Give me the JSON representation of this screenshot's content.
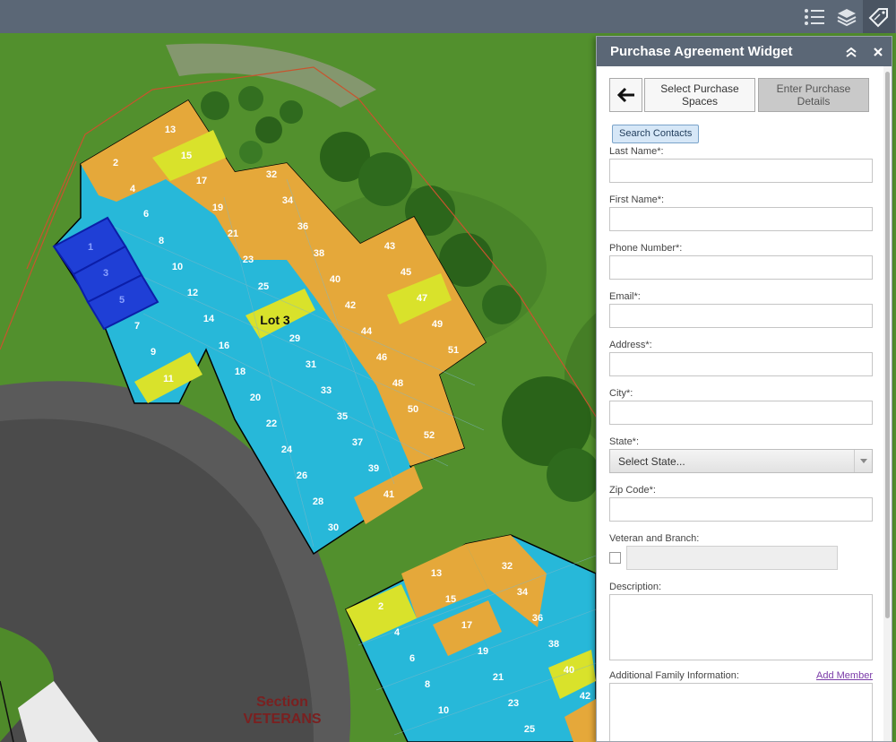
{
  "toolbar": {
    "icons": [
      "list-icon",
      "layers-icon",
      "tag-icon"
    ]
  },
  "map": {
    "lot_label": "Lot 3",
    "section_line1": "Section",
    "section_line2": "VETERANS",
    "colors": {
      "orange": "#e5a83a",
      "blue": "#27b8d9",
      "yellow": "#d9e22b",
      "selected": "#1f3fd6",
      "grass": "#4f8a2a",
      "road": "#5a5a5a"
    }
  },
  "widget": {
    "title": "Purchase Agreement Widget",
    "steps": {
      "select_label": "Select Purchase Spaces",
      "enter_label": "Enter Purchase Details"
    },
    "search_contacts_label": "Search Contacts",
    "fields": {
      "last_name": "Last Name*:",
      "first_name": "First Name*:",
      "phone": "Phone Number*:",
      "email": "Email*:",
      "address": "Address*:",
      "city": "City*:",
      "state": "State*:",
      "state_selected": "Select State...",
      "zip": "Zip Code*:",
      "veteran": "Veteran and Branch:",
      "description": "Description:",
      "family": "Additional Family Information:",
      "add_member": "Add Member"
    }
  }
}
